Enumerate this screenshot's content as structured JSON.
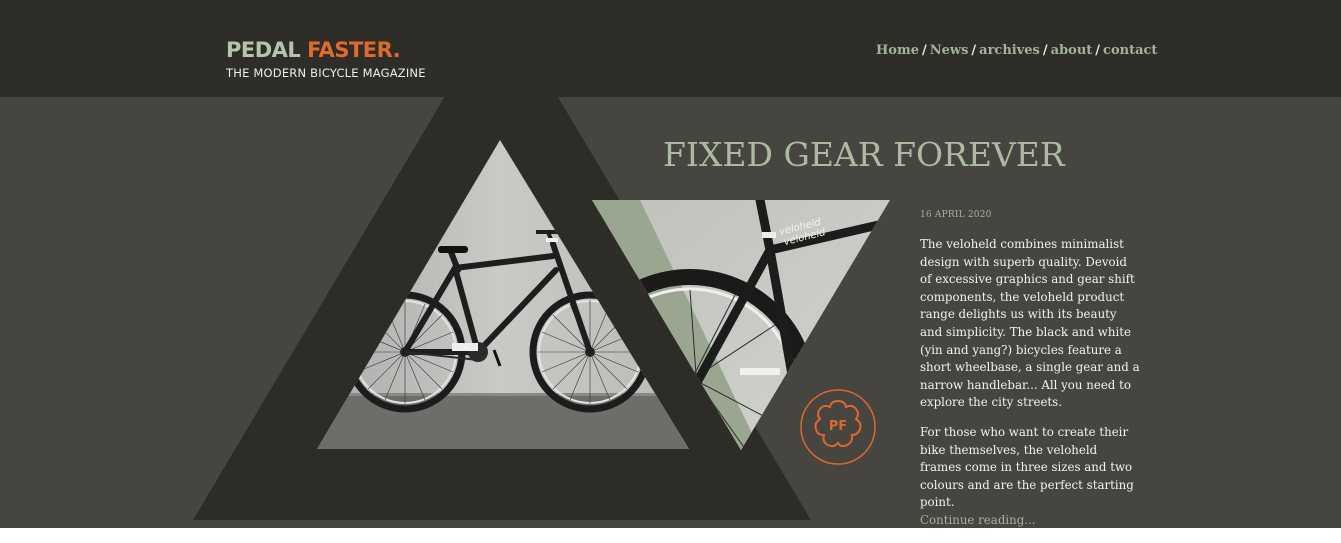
{
  "logo": {
    "word1": "PEDAL",
    "word2": "FASTER.",
    "tagline": "THE MODERN BICYCLE MAGAZINE"
  },
  "nav": {
    "items": [
      {
        "label": "Home"
      },
      {
        "label": "News"
      },
      {
        "label": "archives"
      },
      {
        "label": "about"
      },
      {
        "label": "contact"
      }
    ],
    "separator": "/"
  },
  "article": {
    "title": "FIXED GEAR FOREVER",
    "date": "16 APRIL 2020",
    "paragraph1": "The veloheld combines minimalist design with superb quality. Devoid of excessive graphics and gear shift components, the veloheld product range delights us with its beauty and simplicity. The black and white (yin and yang?) bicycles feature a short wheelbase, a single gear and a narrow handlebar... All you need to explore the city streets.",
    "paragraph2": "For those who want to create their bike themselves, the veloheld frames come in three sizes and two colours and are the perfect starting point.",
    "read_more": "Continue reading..."
  },
  "badge": {
    "text": "PF",
    "icon": "flower-badge-icon"
  },
  "colors": {
    "background": "#47453f",
    "header": "#2e2d28",
    "accent_orange": "#e06a2b",
    "accent_sage": "#adbaa2"
  }
}
